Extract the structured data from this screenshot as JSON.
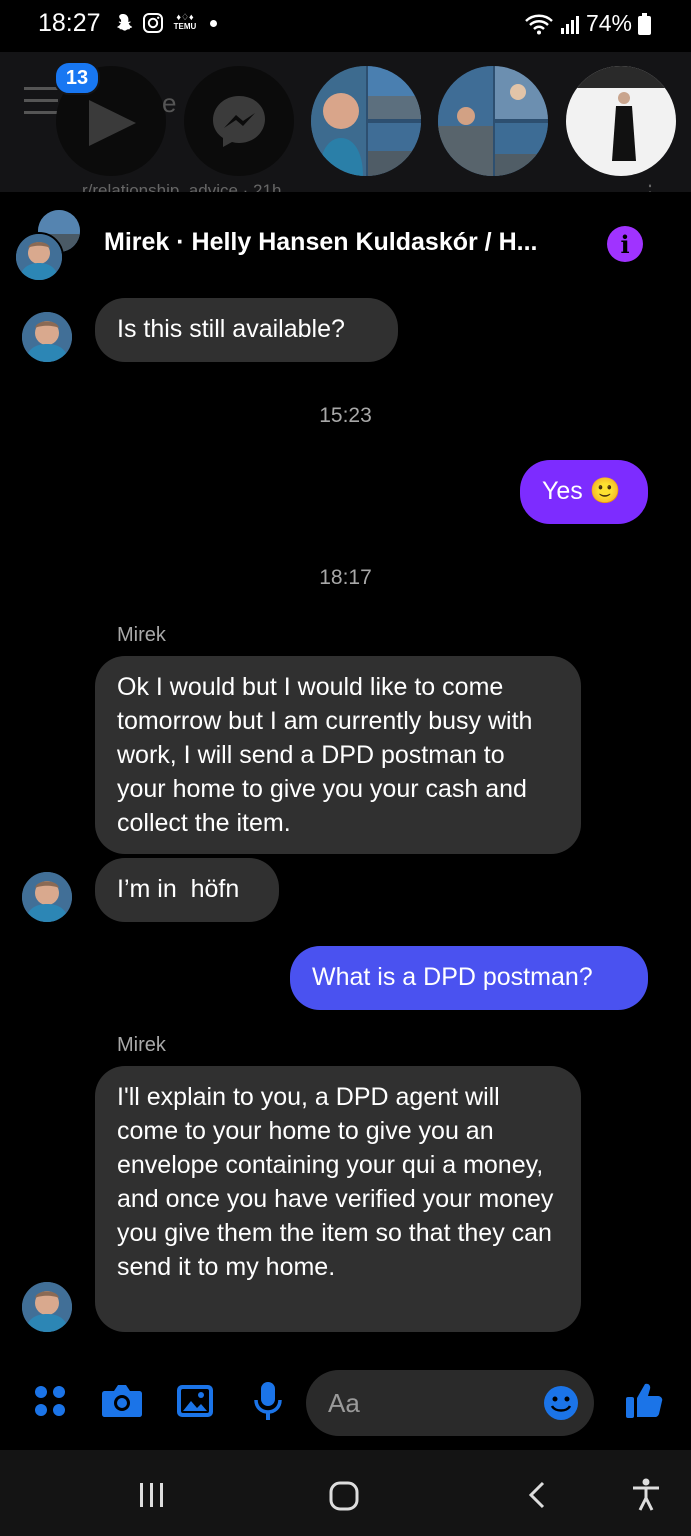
{
  "status_bar": {
    "time": "18:27",
    "battery": "74%",
    "temu_label": "TEMU"
  },
  "background": {
    "notification_count": "13",
    "peek_letter": "e",
    "peek_text": "r/relationship_advice · 21h"
  },
  "chat": {
    "title": "Mirek · Helly Hansen Kuldaskór / H...",
    "messages": [
      {
        "from": "them",
        "text": "Is this still available?"
      },
      {
        "timestamp": "15:23"
      },
      {
        "from": "me",
        "text": "Yes 🙂"
      },
      {
        "timestamp": "18:17"
      },
      {
        "sender": "Mirek"
      },
      {
        "from": "them",
        "text": "Ok I would but I would like to come tomorrow but I am currently busy with work, I will send a DPD postman to your home to give you your cash and collect the item."
      },
      {
        "from": "them",
        "text": "I’m in  höfn"
      },
      {
        "from": "me",
        "text": "What is a DPD postman?"
      },
      {
        "sender": "Mirek"
      },
      {
        "from": "them",
        "text": "I'll explain to you, a DPD agent will come to your home to give you an envelope containing your qui a money, and once you have verified your money you give them the item so that they can send it to my home."
      }
    ]
  },
  "composer": {
    "placeholder": "Aa"
  },
  "colors": {
    "accent_purple": "#7d2cff",
    "accent_blue": "#4a52f0",
    "icon_blue": "#1b74e8",
    "incoming_bubble": "#303030"
  }
}
